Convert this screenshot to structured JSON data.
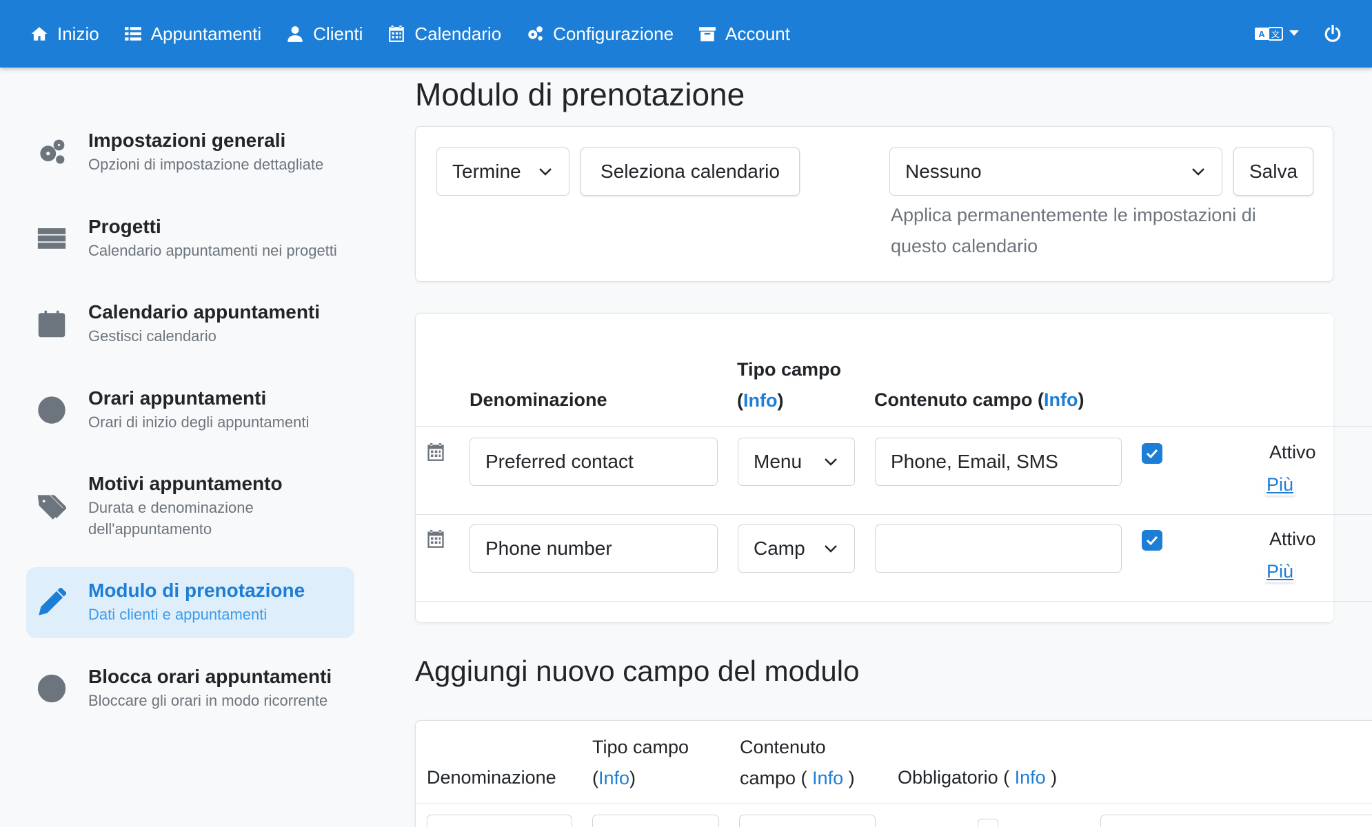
{
  "nav": {
    "items": [
      {
        "label": "Inizio",
        "icon": "home-icon"
      },
      {
        "label": "Appuntamenti",
        "icon": "list-icon"
      },
      {
        "label": "Clienti",
        "icon": "user-icon"
      },
      {
        "label": "Calendario",
        "icon": "calendar-icon"
      },
      {
        "label": "Configurazione",
        "icon": "gears-icon"
      },
      {
        "label": "Account",
        "icon": "archive-icon"
      }
    ],
    "right_icons": [
      "language-icon",
      "power-icon"
    ]
  },
  "sidebar": {
    "items": [
      {
        "title": "Impostazioni generali",
        "subtitle": "Opzioni di impostazione dettagliate",
        "icon": "gears-icon",
        "active": false
      },
      {
        "title": "Progetti",
        "subtitle": "Calendario appuntamenti nei progetti",
        "icon": "server-icon",
        "active": false
      },
      {
        "title": "Calendario appuntamenti",
        "subtitle": "Gestisci calendario",
        "icon": "calendar-icon",
        "active": false
      },
      {
        "title": "Orari appuntamenti",
        "subtitle": "Orari di inizio degli appuntamenti",
        "icon": "clock-icon",
        "active": false
      },
      {
        "title": "Motivi appuntamento",
        "subtitle": "Durata e denominazione dell'appuntamento",
        "icon": "tags-icon",
        "active": false
      },
      {
        "title": "Modulo di prenotazione",
        "subtitle": "Dati clienti e appuntamenti",
        "icon": "pencil-icon",
        "active": true
      },
      {
        "title": "Blocca orari appuntamenti",
        "subtitle": "Bloccare gli orari in modo ricorrente",
        "icon": "ban-icon",
        "active": false
      }
    ]
  },
  "main": {
    "title": "Modulo di prenotazione",
    "filter": {
      "termine_select": "Termine",
      "select_calendar_button": "Seleziona calendario",
      "calendar_select": "Nessuno",
      "save_button": "Salva",
      "help": "Applica permanentemente le impostazioni di questo calendario"
    },
    "fields_table": {
      "headers": {
        "name": "Denominazione",
        "type": "Tipo campo",
        "content": "Contenuto campo",
        "info": "Info"
      },
      "rows": [
        {
          "name": "Preferred contact",
          "type": "Menu",
          "content": "Phone, Email, SMS",
          "checked": true,
          "status": "Attivo",
          "more": "Più"
        },
        {
          "name": "Phone number",
          "type": "Camp",
          "content": "",
          "checked": true,
          "status": "Attivo",
          "more": "Più"
        }
      ]
    },
    "add_section": {
      "title": "Aggiungi nuovo campo del modulo",
      "headers": {
        "name": "Denominazione",
        "type": "Tipo campo",
        "content": "Contenuto campo",
        "required": "Obbligatorio",
        "info": "Info"
      }
    }
  },
  "colors": {
    "accent": "#1c7ed6",
    "active_bg": "#dfeefb",
    "muted": "#6c757d"
  }
}
